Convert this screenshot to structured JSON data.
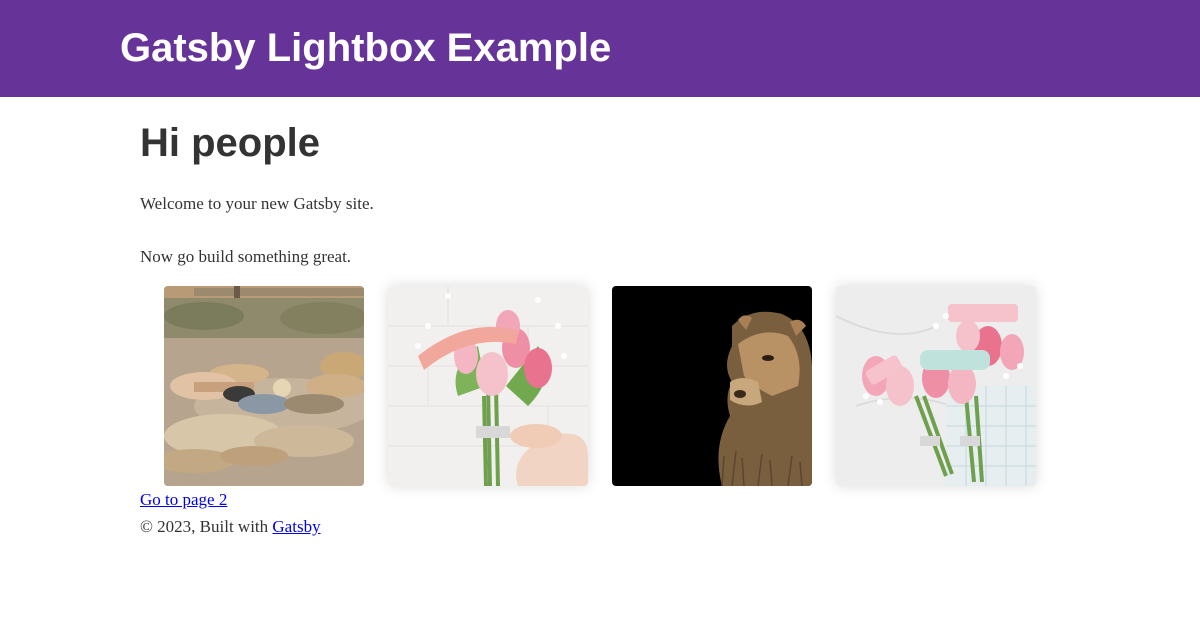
{
  "header": {
    "site_title": "Gatsby Lightbox Example"
  },
  "main": {
    "heading": "Hi people",
    "paragraphs": [
      "Welcome to your new Gatsby site.",
      "Now go build something great."
    ],
    "gallery": [
      {
        "subject": "person lying among sleeping lions on dirt ground"
      },
      {
        "subject": "hand holding bouquet of pink tulips with gypsophila"
      },
      {
        "subject": "lioness face emerging from dark background"
      },
      {
        "subject": "two pink tulip bouquets with tags on marble and tray"
      }
    ],
    "page2_link": "Go to page 2"
  },
  "footer": {
    "copyright": "© 2023, Built with",
    "link": "Gatsby"
  },
  "colors": {
    "header_bg": "#663399",
    "text": "#333333",
    "link": "#0000ee"
  }
}
